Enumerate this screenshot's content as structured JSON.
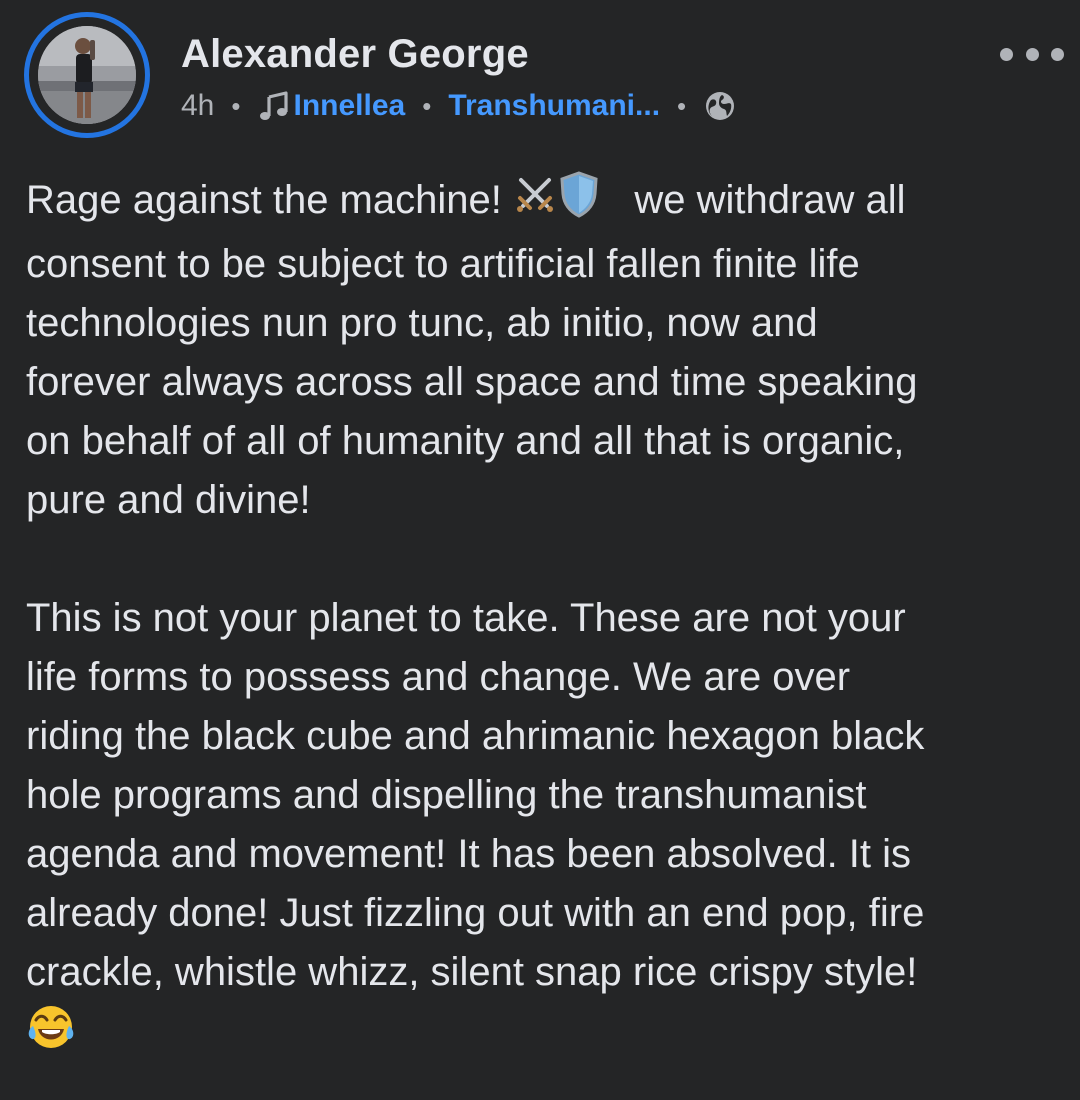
{
  "post": {
    "author": "Alexander George",
    "time": "4h",
    "separator": "•",
    "music_link": "Innellea",
    "group_link": "Transhumani...",
    "privacy_icon": "globe-icon",
    "more_icon": "more-horizontal-icon",
    "body_lines_1": [
      "Rage against the machine!",
      "we withdraw all",
      "consent to be subject to artificial fallen finite life",
      "technologies nun pro tunc, ab initio, now and",
      "forever always across all space and time speaking",
      "on behalf of all of humanity and all that is organic,",
      "pure and divine!"
    ],
    "body_lines_2": [
      "This is not your planet to take. These are not your",
      "life forms to possess and change. We are over",
      "riding the black cube and ahrimanic hexagon black",
      "hole programs and dispelling the transhumanist",
      "agenda and movement! It has been absolved. It is",
      "already done! Just fizzling out with an end pop, fire",
      "crackle, whistle whizz, silent snap rice crispy style!"
    ],
    "emojis": [
      "crossed-swords-icon",
      "shield-icon",
      "tears-of-joy-icon"
    ]
  },
  "colors": {
    "background": "#242526",
    "text_primary": "#e4e6eb",
    "text_secondary": "#b0b3b8",
    "link": "#4599ff",
    "avatar_ring": "#2374e1"
  }
}
